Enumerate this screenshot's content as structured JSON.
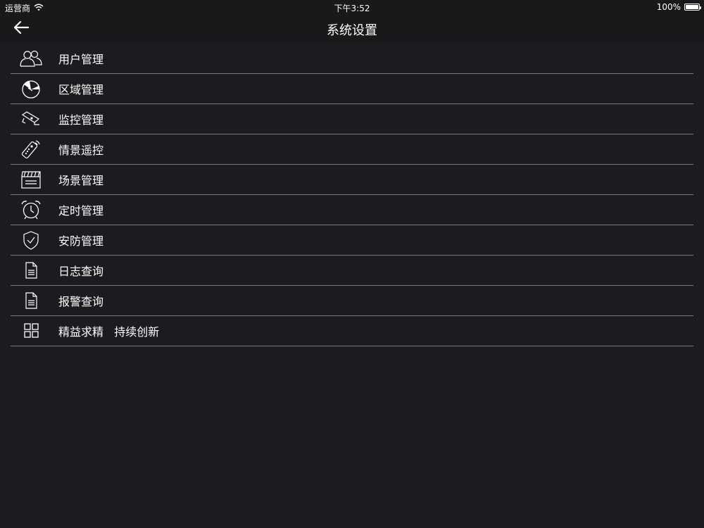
{
  "status_bar": {
    "carrier": "运营商",
    "time": "下午3:52",
    "battery": "100%",
    "battery_level": 1.0,
    "wifi_icon": "wifi-icon",
    "battery_icon": "battery-icon"
  },
  "nav": {
    "title": "系统设置",
    "back_icon": "arrow-left-icon"
  },
  "menu": {
    "items": [
      {
        "label": "用户管理",
        "icon": "users-icon"
      },
      {
        "label": "区域管理",
        "icon": "area-pie-icon"
      },
      {
        "label": "监控管理",
        "icon": "camera-icon"
      },
      {
        "label": "情景遥控",
        "icon": "remote-control-icon"
      },
      {
        "label": "场景管理",
        "icon": "clapperboard-icon"
      },
      {
        "label": "定时管理",
        "icon": "alarm-clock-icon"
      },
      {
        "label": "安防管理",
        "icon": "shield-check-icon"
      },
      {
        "label": "日志查询",
        "icon": "document-icon"
      },
      {
        "label": "报警查询",
        "icon": "document-icon"
      },
      {
        "label": "精益求精   持续创新",
        "icon": "grid-icon"
      }
    ]
  },
  "colors": {
    "background": "#1c1b1f",
    "bar_background": "#19191b",
    "divider": "#7a7a7e",
    "text": "#ffffff"
  }
}
